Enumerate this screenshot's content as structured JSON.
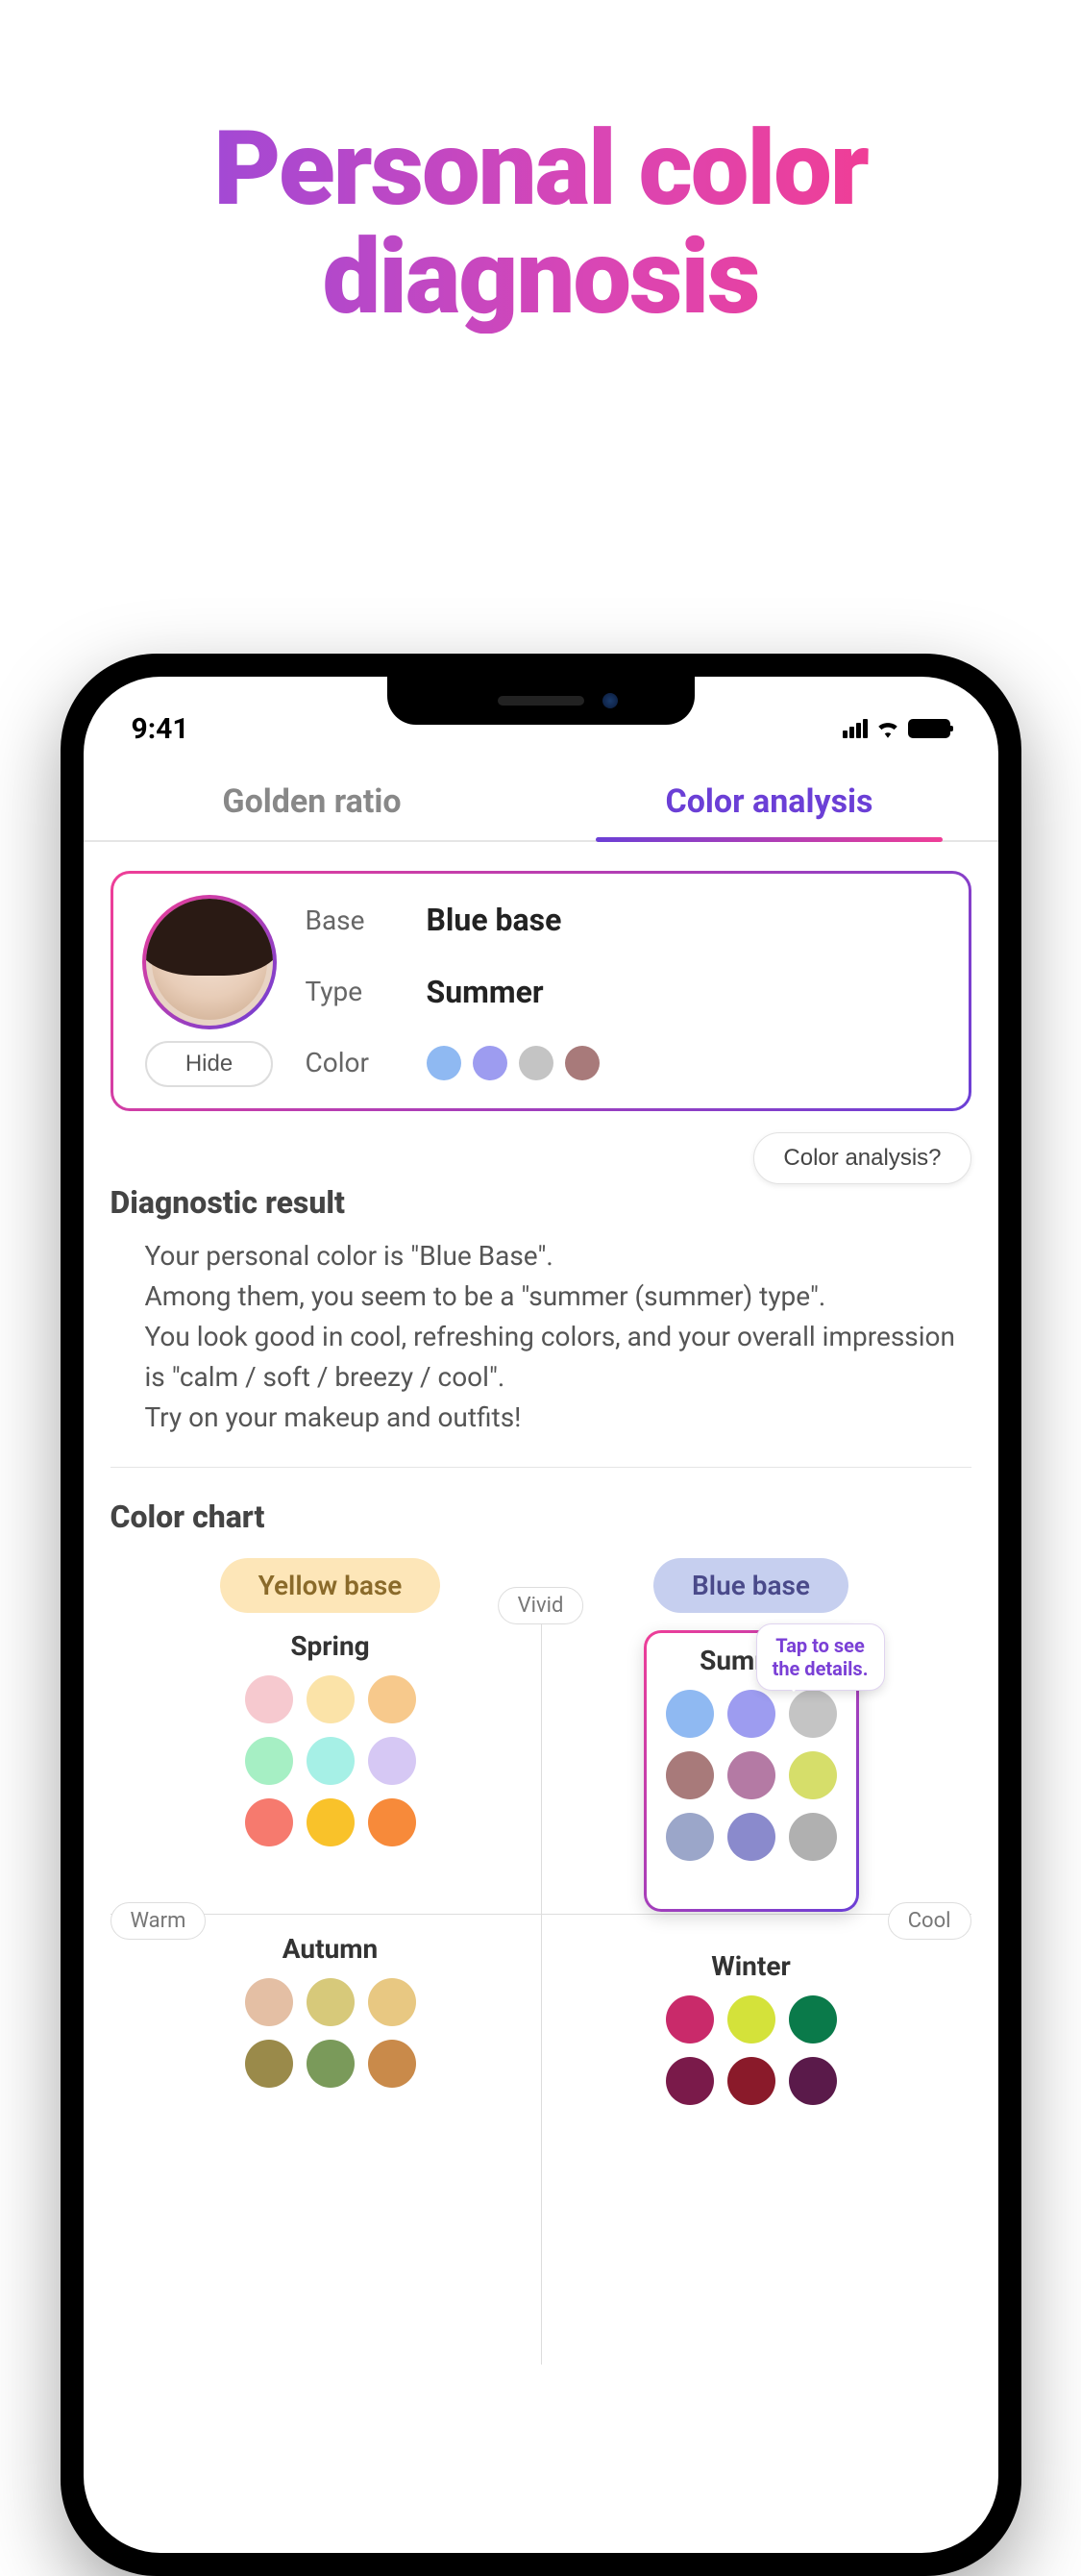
{
  "hero": {
    "line1": "Personal color",
    "line2": "diagnosis"
  },
  "status": {
    "time": "9:41"
  },
  "tabs": {
    "golden": "Golden ratio",
    "color": "Color analysis"
  },
  "card": {
    "base_label": "Base",
    "base_value": "Blue base",
    "type_label": "Type",
    "type_value": "Summer",
    "color_label": "Color",
    "colors": [
      "#8fb9f2",
      "#9d9cf0",
      "#c4c4c4",
      "#a87a7a"
    ],
    "hide_btn": "Hide"
  },
  "help_btn": "Color analysis?",
  "diag": {
    "title": "Diagnostic result",
    "l1": "Your personal color is \"Blue Base\".",
    "l2": "Among them, you seem to be a \"summer (summer) type\".",
    "l3": "You look good in cool, refreshing colors, and your overall impression is \"calm / soft / breezy / cool\".",
    "l4": "Try on your makeup and outfits!"
  },
  "chart": {
    "title": "Color chart",
    "yellow_base": "Yellow base",
    "blue_base": "Blue base",
    "vivid": "Vivid",
    "warm": "Warm",
    "cool": "Cool",
    "tooltip_l1": "Tap to see",
    "tooltip_l2": "the details.",
    "seasons": {
      "spring": {
        "name": "Spring",
        "colors": [
          "#f6c9cf",
          "#fbe3a8",
          "#f7c98c",
          "#a6efc4",
          "#a6f0e6",
          "#d6c8f4",
          "#f67a6e",
          "#f9c22a",
          "#f78a3a"
        ]
      },
      "summer": {
        "name": "Summer",
        "colors": [
          "#8fb9f2",
          "#9d9cf0",
          "#c4c4c4",
          "#a87a7a",
          "#b47aa4",
          "#d6de6a",
          "#9ba6c9",
          "#8a8acc",
          "#b0b0b0"
        ]
      },
      "autumn": {
        "name": "Autumn",
        "colors": [
          "#e4bfa4",
          "#d7c97a",
          "#e8c882",
          "#9a8a4a",
          "#7a9a5a",
          "#c98a4a"
        ]
      },
      "winter": {
        "name": "Winter",
        "colors": [
          "#c92a6a",
          "#d4e23a",
          "#0a7a4a",
          "#7a1a4a",
          "#8a1a2a",
          "#5a1a4a"
        ]
      }
    }
  }
}
